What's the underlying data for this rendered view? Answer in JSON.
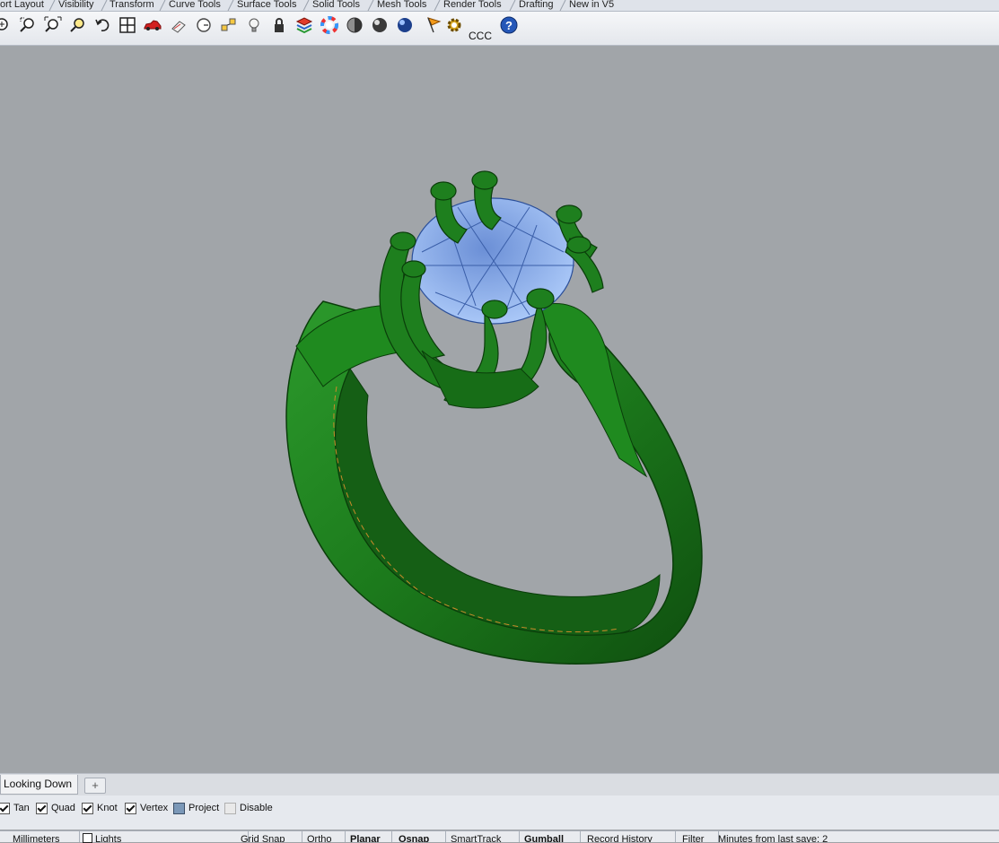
{
  "menu_tabs": [
    "ort Layout",
    "Visibility",
    "Transform",
    "Curve Tools",
    "Surface Tools",
    "Solid Tools",
    "Mesh Tools",
    "Render Tools",
    "Drafting",
    "New in V5"
  ],
  "toolbar": {
    "icons": [
      "zoom-in-icon",
      "zoom-window-icon",
      "zoom-extents-icon",
      "zoom-selected-icon",
      "undo-view-icon",
      "four-viewports-icon",
      "car-icon",
      "properties-icon",
      "clock-icon",
      "snap-objects-icon",
      "lightbulb-icon",
      "lock-icon",
      "layer-icon",
      "color-wheel-icon",
      "shaded-sphere-icon",
      "rendered-sphere-icon",
      "blue-sphere-icon",
      "flag-icon",
      "gear-icon",
      "help-icon"
    ],
    "ccc_label": "CCC"
  },
  "viewport": {
    "tab_label": "Looking Down",
    "add_tab": "+",
    "background": "#a1a5a9",
    "model_color": "#1e7a1e",
    "gem_color": "#8fb6f2"
  },
  "osnap": [
    {
      "label": "Tan",
      "state": "checked"
    },
    {
      "label": "Quad",
      "state": "checked"
    },
    {
      "label": "Knot",
      "state": "checked"
    },
    {
      "label": "Vertex",
      "state": "checked"
    },
    {
      "label": "Project",
      "state": "filled"
    },
    {
      "label": "Disable",
      "state": "gray"
    }
  ],
  "status": {
    "units": "Millimeters",
    "layer": "Lights",
    "grid_snap": "Grid Snap",
    "ortho": "Ortho",
    "planar": "Planar",
    "osnap": "Osnap",
    "smarttrack": "SmartTrack",
    "gumball": "Gumball",
    "record_history": "Record History",
    "filter": "Filter",
    "last_save": "Minutes from last save: 2"
  }
}
